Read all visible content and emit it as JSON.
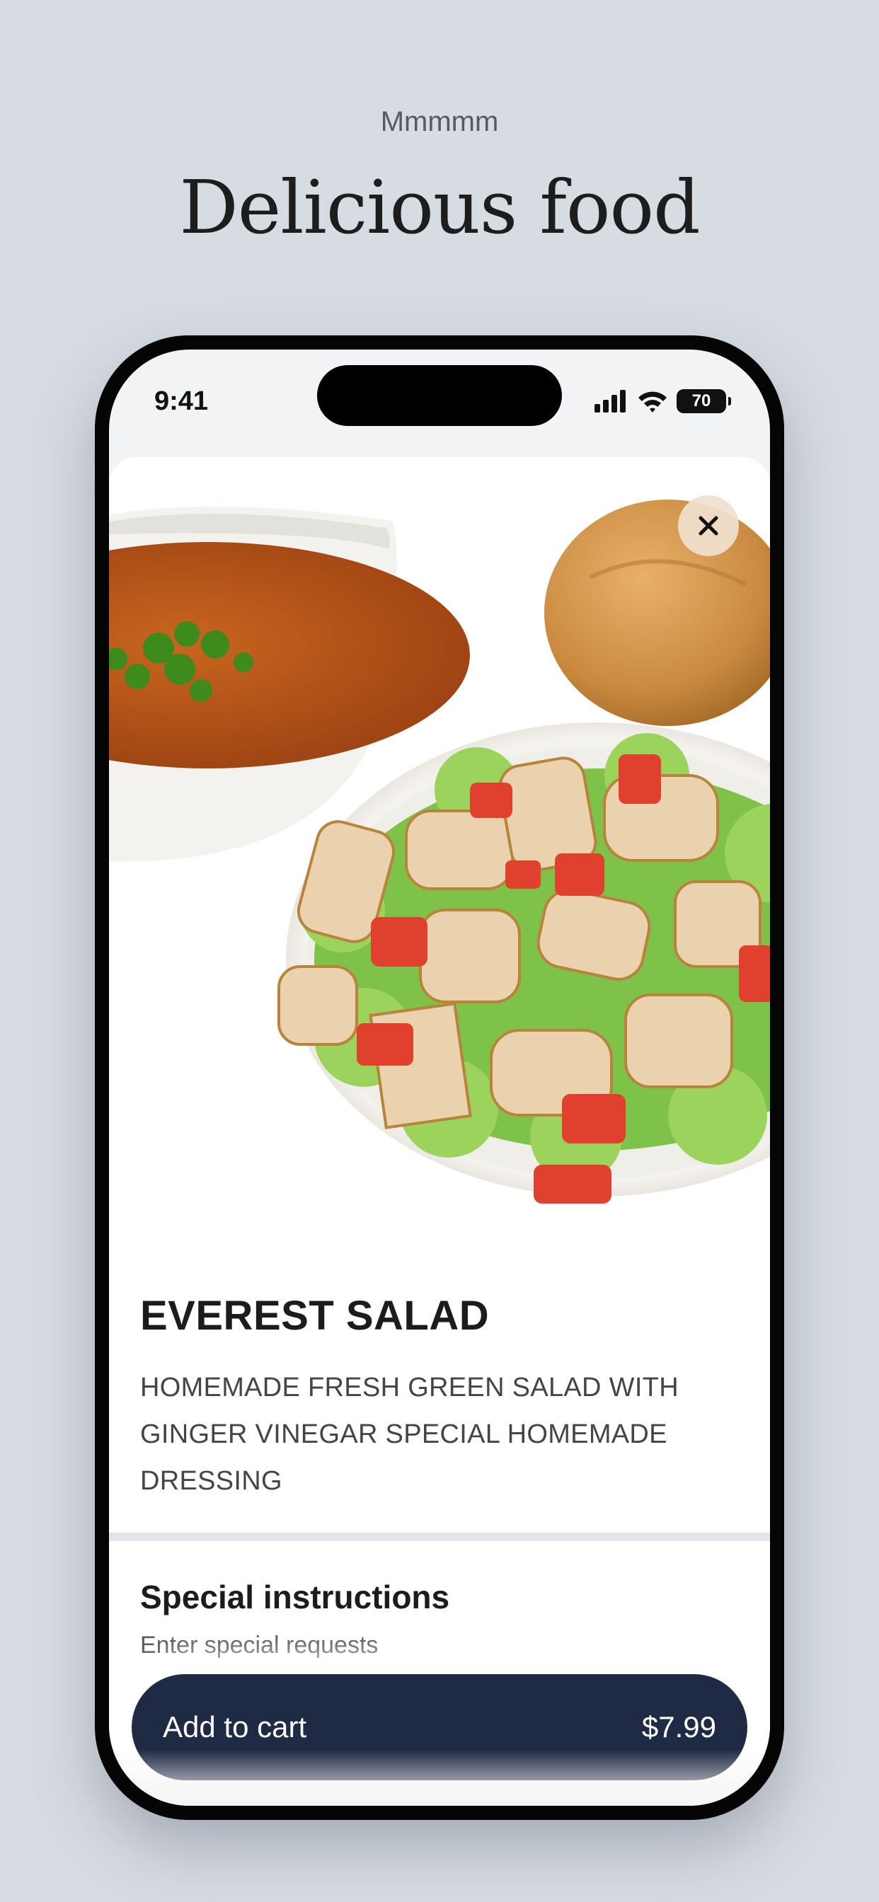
{
  "header": {
    "kicker": "Mmmmm",
    "headline": "Delicious food"
  },
  "status_bar": {
    "time": "9:41",
    "battery": "70",
    "icons": [
      "signal-icon",
      "wifi-icon",
      "battery-icon"
    ]
  },
  "product": {
    "name": "EVEREST SALAD",
    "description": "HOMEMADE FRESH GREEN SALAD WITH GINGER VINEGAR SPECIAL HOMEMADE DRESSING",
    "image": "salad-soup-bread-photo"
  },
  "instructions": {
    "title": "Special instructions",
    "placeholder": "Enter special requests"
  },
  "cta": {
    "label": "Add to cart",
    "price": "$7.99"
  },
  "colors": {
    "background": "#d7dce3",
    "button": "#1f2a44",
    "divider": "#e2e5ea"
  }
}
